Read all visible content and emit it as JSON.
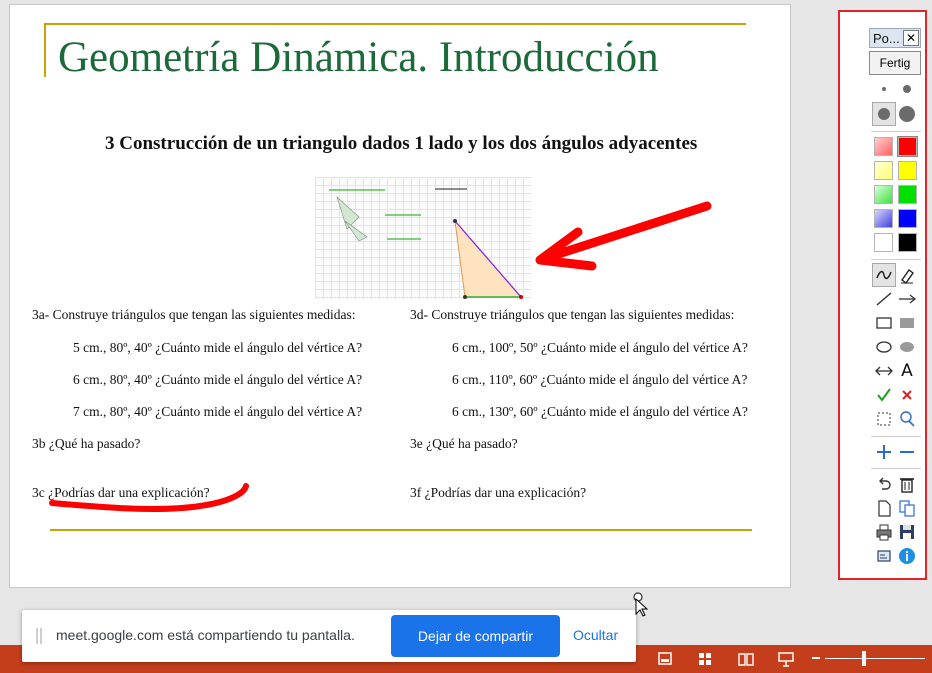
{
  "slide": {
    "title": "Geometría Dinámica. Introducción",
    "heading": "3 Construcción de un triangulo dados 1 lado y los dos ángulos adyacentes",
    "left_column": {
      "intro": "3a- Construye triángulos que tengan las siguientes medidas:",
      "items": [
        "5 cm., 80º, 40º ¿Cuánto mide el ángulo del vértice A?",
        "6 cm., 80º, 40º  ¿Cuánto mide el ángulo del vértice A?",
        "7 cm., 80º, 40º ¿Cuánto mide el ángulo del vértice A?"
      ],
      "q_b": "3b ¿Qué ha pasado?",
      "q_c": "3c ¿Podrías dar una explicación?"
    },
    "right_column": {
      "intro": "3d- Construye triángulos que tengan las siguientes medidas:",
      "items": [
        "6 cm., 100º, 50º ¿Cuánto mide el ángulo del vértice A?",
        "6 cm., 110º, 60º ¿Cuánto mide el ángulo del vértice A?",
        "6 cm., 130º, 60º ¿Cuánto mide el ángulo del vértice A?"
      ],
      "q_e": "3e ¿Qué ha pasado?",
      "q_f": "3f ¿Podrías dar una explicación?"
    }
  },
  "palette": {
    "title": "Po...",
    "close_symbol": "✕",
    "done_label": "Fertig",
    "colors": [
      "#ff8a8a",
      "#ff0000",
      "#ffff80",
      "#ffff00",
      "#80ff80",
      "#00e000",
      "#8080ff",
      "#0000ff",
      "#ffffff",
      "#000000"
    ],
    "tools": [
      "freehand-icon",
      "eraser-icon",
      "line-icon",
      "arrow-icon",
      "rectangle-icon",
      "filled-rectangle-icon",
      "ellipse-icon",
      "filled-ellipse-icon",
      "double-arrow-icon",
      "text-icon",
      "checkmark-icon",
      "cross-icon",
      "select-area-icon",
      "zoom-icon",
      "plus-icon",
      "minus-icon",
      "undo-icon",
      "trash-icon",
      "new-page-icon",
      "copy-icon",
      "print-icon",
      "save-icon",
      "settings-icon",
      "info-icon"
    ],
    "text_tool_glyph": "A"
  },
  "share_bar": {
    "message": "meet.google.com está compartiendo tu pantalla.",
    "stop_label": "Dejar de compartir",
    "hide_label": "Ocultar"
  },
  "colors": {
    "title_green": "#1c6a3a",
    "rule_gold": "#c8a400",
    "annotation_red": "#ff0000",
    "share_blue": "#1a73e8",
    "statusbar": "#c43e1c"
  }
}
